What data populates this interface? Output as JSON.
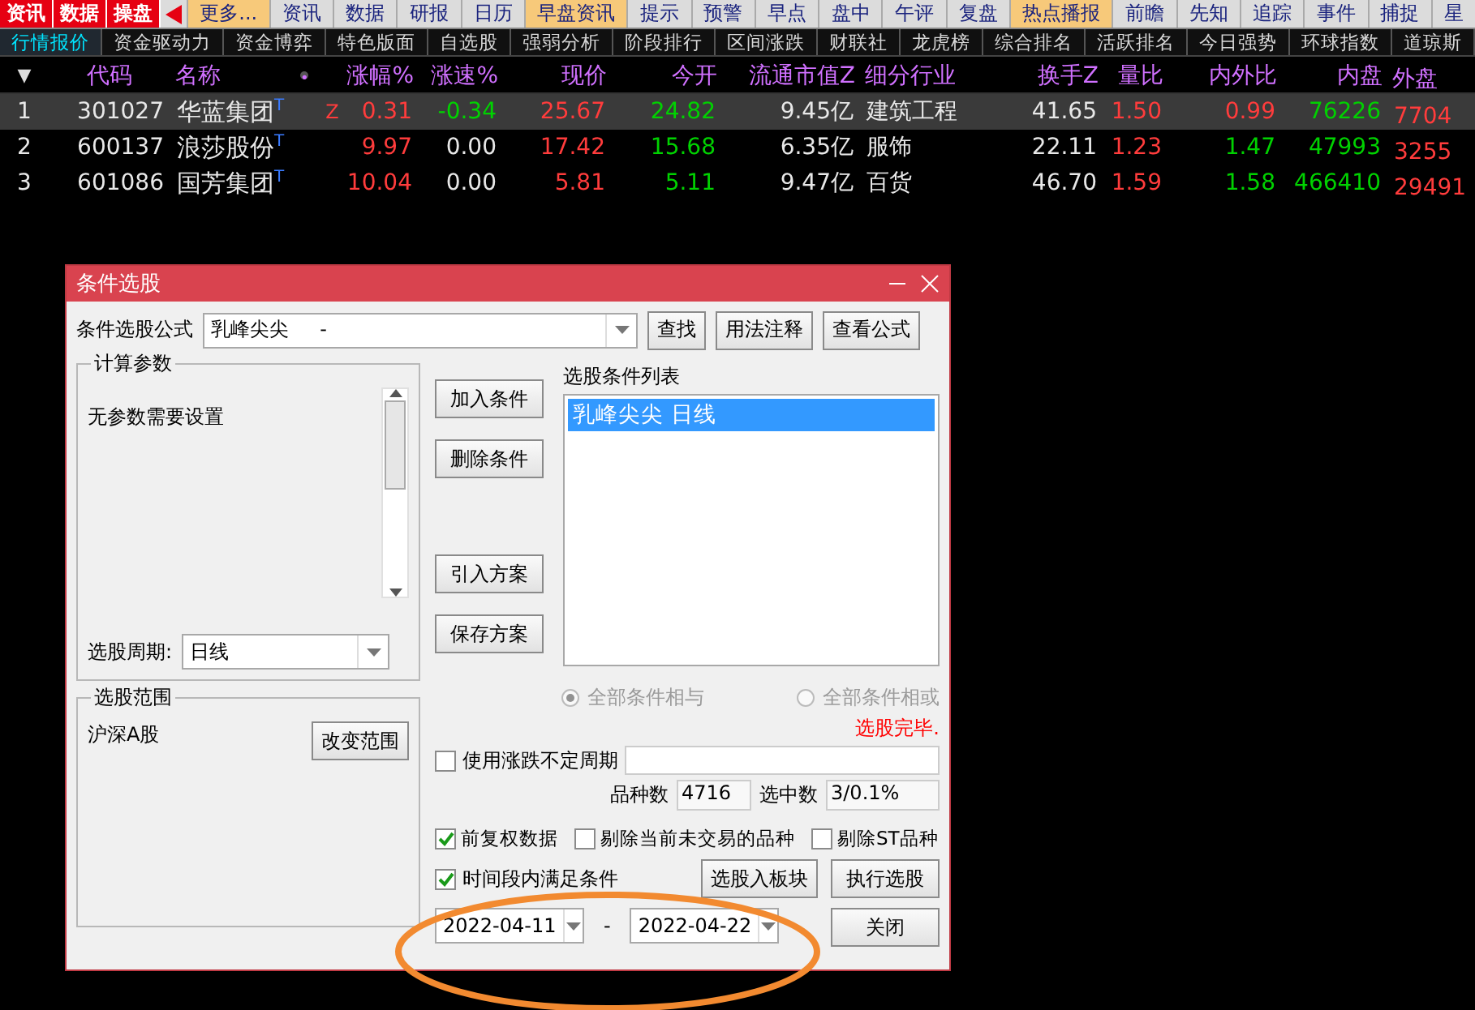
{
  "top_nav": {
    "brand_tabs": [
      {
        "label": "资讯"
      },
      {
        "label": "数据"
      },
      {
        "label": "操盘"
      }
    ],
    "tabs": [
      {
        "label": "更多...",
        "highlighted": true
      },
      {
        "label": "资讯",
        "highlighted": false
      },
      {
        "label": "数据",
        "highlighted": false
      },
      {
        "label": "研报",
        "highlighted": false
      },
      {
        "label": "日历",
        "highlighted": false
      },
      {
        "label": "早盘资讯",
        "highlighted": true
      },
      {
        "label": "提示",
        "highlighted": false
      },
      {
        "label": "预警",
        "highlighted": false
      },
      {
        "label": "早点",
        "highlighted": false
      },
      {
        "label": "盘中",
        "highlighted": false
      },
      {
        "label": "午评",
        "highlighted": false
      },
      {
        "label": "复盘",
        "highlighted": false
      },
      {
        "label": "热点播报",
        "highlighted": true
      },
      {
        "label": "前瞻",
        "highlighted": false
      },
      {
        "label": "先知",
        "highlighted": false
      },
      {
        "label": "追踪",
        "highlighted": false
      },
      {
        "label": "事件",
        "highlighted": false
      },
      {
        "label": "捕捉",
        "highlighted": false
      },
      {
        "label": "星",
        "highlighted": false
      }
    ]
  },
  "sub_tabs": [
    {
      "label": "行情报价",
      "selected": true
    },
    {
      "label": "资金驱动力",
      "selected": false
    },
    {
      "label": "资金博弈",
      "selected": false
    },
    {
      "label": "特色版面",
      "selected": false
    },
    {
      "label": "自选股",
      "selected": false
    },
    {
      "label": "强弱分析",
      "selected": false
    },
    {
      "label": "阶段排行",
      "selected": false
    },
    {
      "label": "区间涨跌",
      "selected": false
    },
    {
      "label": "财联社",
      "selected": false
    },
    {
      "label": "龙虎榜",
      "selected": false
    },
    {
      "label": "综合排名",
      "selected": false
    },
    {
      "label": "活跃排名",
      "selected": false
    },
    {
      "label": "今日强势",
      "selected": false
    },
    {
      "label": "环球指数",
      "selected": false
    },
    {
      "label": "道琼斯",
      "selected": false
    }
  ],
  "table": {
    "columns": [
      {
        "label": "▼",
        "kind": "index"
      },
      {
        "label": "代码",
        "kind": "code"
      },
      {
        "label": "名称",
        "kind": "name"
      },
      {
        "label": "•",
        "kind": "dot"
      },
      {
        "label": "涨幅%",
        "kind": "num"
      },
      {
        "label": "涨速%",
        "kind": "num"
      },
      {
        "label": "现价",
        "kind": "num"
      },
      {
        "label": "今开",
        "kind": "num"
      },
      {
        "label": "流通市值Z",
        "kind": "num"
      },
      {
        "label": "细分行业",
        "kind": "text"
      },
      {
        "label": "换手Z",
        "kind": "num"
      },
      {
        "label": "量比",
        "kind": "num"
      },
      {
        "label": "内外比",
        "kind": "num"
      },
      {
        "label": "内盘",
        "kind": "num"
      },
      {
        "label": "外盘",
        "kind": "last"
      }
    ],
    "rows": [
      {
        "selected": true,
        "cells": [
          {
            "text": "1"
          },
          {
            "text": "301027"
          },
          {
            "text": "华蓝集团",
            "tag": "T"
          },
          {
            "text": ""
          },
          {
            "text": "0.31",
            "color": "#ff3c3c",
            "flag": "Z"
          },
          {
            "text": "-0.34",
            "color": "#00d200"
          },
          {
            "text": "25.67",
            "color": "#ff3c3c"
          },
          {
            "text": "24.82",
            "color": "#00d200"
          },
          {
            "text": "9.45亿"
          },
          {
            "text": "建筑工程"
          },
          {
            "text": "41.65"
          },
          {
            "text": "1.50",
            "color": "#ff3c3c"
          },
          {
            "text": "0.99",
            "color": "#ff3c3c"
          },
          {
            "text": "76226",
            "color": "#00d200"
          },
          {
            "text": "7704",
            "color": "#ff3c3c"
          }
        ]
      },
      {
        "selected": false,
        "cells": [
          {
            "text": "2"
          },
          {
            "text": "600137"
          },
          {
            "text": "浪莎股份",
            "tag": "T"
          },
          {
            "text": ""
          },
          {
            "text": "9.97",
            "color": "#ff3c3c"
          },
          {
            "text": "0.00"
          },
          {
            "text": "17.42",
            "color": "#ff3c3c"
          },
          {
            "text": "15.68",
            "color": "#00d200"
          },
          {
            "text": "6.35亿"
          },
          {
            "text": "服饰"
          },
          {
            "text": "22.11"
          },
          {
            "text": "1.23",
            "color": "#ff3c3c"
          },
          {
            "text": "1.47",
            "color": "#00d200"
          },
          {
            "text": "47993",
            "color": "#00d200"
          },
          {
            "text": "3255",
            "color": "#ff3c3c"
          }
        ]
      },
      {
        "selected": false,
        "cells": [
          {
            "text": "3"
          },
          {
            "text": "601086"
          },
          {
            "text": "国芳集团",
            "tag": "T"
          },
          {
            "text": ""
          },
          {
            "text": "10.04",
            "color": "#ff3c3c"
          },
          {
            "text": "0.00"
          },
          {
            "text": "5.81",
            "color": "#ff3c3c"
          },
          {
            "text": "5.11",
            "color": "#00d200"
          },
          {
            "text": "9.47亿"
          },
          {
            "text": "百货"
          },
          {
            "text": "46.70"
          },
          {
            "text": "1.59",
            "color": "#ff3c3c"
          },
          {
            "text": "1.58",
            "color": "#00d200"
          },
          {
            "text": "466410",
            "color": "#00d200"
          },
          {
            "text": "29491",
            "color": "#ff3c3c"
          }
        ]
      }
    ]
  },
  "dialog": {
    "title": "条件选股",
    "formula_label": "条件选股公式",
    "formula_value": "乳峰尖尖     -",
    "formula_buttons": [
      "查找",
      "用法注释",
      "查看公式"
    ],
    "params_group": {
      "title": "计算参数",
      "message": "无参数需要设置",
      "period_label": "选股周期:",
      "period_value": "日线"
    },
    "scope_group": {
      "title": "选股范围",
      "value": "沪深A股",
      "button": "改变范围"
    },
    "action_buttons": [
      "加入条件",
      "删除条件",
      "引入方案",
      "保存方案"
    ],
    "condition_list": {
      "title": "选股条件列表",
      "items": [
        {
          "label": "乳峰尖尖  日线",
          "selected": true
        }
      ]
    },
    "logic_radios": [
      {
        "label": "全部条件相与",
        "selected": true,
        "disabled": true
      },
      {
        "label": "全部条件相或",
        "selected": false,
        "disabled": true
      }
    ],
    "status": "选股完毕.",
    "variable_period": {
      "label": "使用涨跌不定周期",
      "checked": false
    },
    "counts": [
      {
        "label": "品种数",
        "value": "4716"
      },
      {
        "label": "选中数",
        "value": "3/0.1%"
      }
    ],
    "options": [
      {
        "label": "前复权数据",
        "checked": true
      },
      {
        "label": "剔除当前未交易的品种",
        "checked": false
      },
      {
        "label": "剔除ST品种",
        "checked": false
      }
    ],
    "time_range": {
      "label": "时间段内满足条件",
      "checked": true,
      "start": "2022-04-11",
      "separator": "-",
      "end": "2022-04-22"
    },
    "buttons": [
      "选股入板块",
      "执行选股",
      "关闭"
    ]
  }
}
